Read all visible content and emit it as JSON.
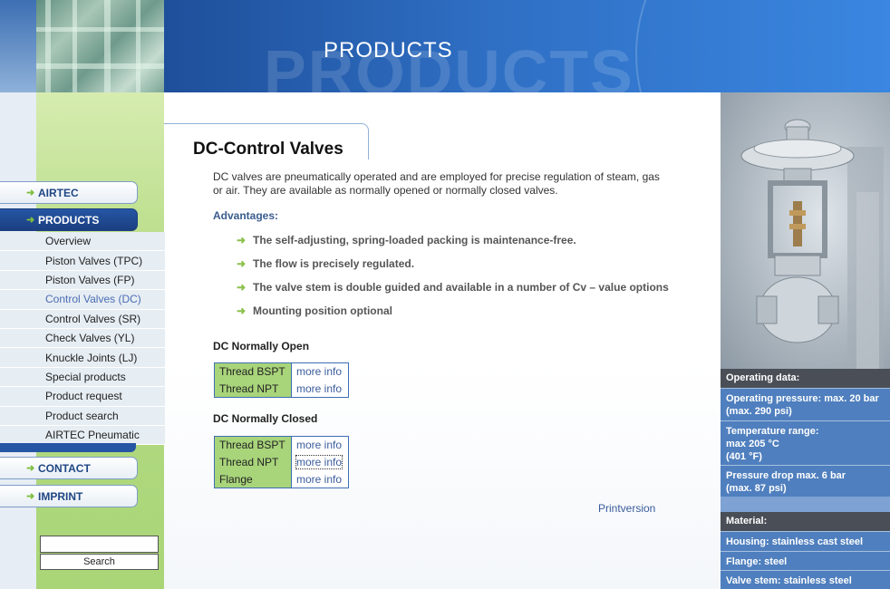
{
  "header": {
    "title": "PRODUCTS",
    "watermark": "PRODUCTS"
  },
  "page": {
    "title": "DC-Control Valves",
    "intro": "DC valves are pneumatically operated and are employed for precise regulation of steam, gas or air. They are available as normally opened or normally closed valves.",
    "advantages_label": "Advantages:",
    "advantages": [
      "The self-adjusting, spring-loaded packing is maintenance-free.",
      "The flow is precisely regulated.",
      "The valve stem is double guided and available in a number of Cv – value options",
      "Mounting position optional"
    ],
    "normally_open": {
      "heading": "DC Normally Open",
      "rows": [
        {
          "label": "Thread BSPT",
          "link": "more info"
        },
        {
          "label": "Thread NPT",
          "link": "more info"
        }
      ]
    },
    "normally_closed": {
      "heading": "DC Normally Closed",
      "rows": [
        {
          "label": "Thread BSPT",
          "link": "more info"
        },
        {
          "label": "Thread NPT",
          "link": "more info"
        },
        {
          "label": "Flange",
          "link": "more info"
        }
      ]
    },
    "printversion": "Printversion"
  },
  "nav": {
    "arrow": "➜",
    "airtec": "AIRTEC",
    "products": "PRODUCTS",
    "contact": "CONTACT",
    "imprint": "IMPRINT",
    "sub_items": [
      "Overview",
      "Piston Valves (TPC)",
      "Piston Valves (FP)",
      "Control Valves (DC)",
      "Control Valves (SR)",
      "Check Valves (YL)",
      "Knuckle Joints (LJ)",
      "Special products",
      "Product request",
      "Product search",
      "AIRTEC Pneumatic"
    ],
    "current_sub": "Control Valves (DC)"
  },
  "search": {
    "value": "",
    "button_label": "Search"
  },
  "specs": {
    "operating_heading": "Operating data:",
    "operating_pressure": "Operating pressure: max. 20 bar\n(max. 290 psi)",
    "temperature": "Temperature range:\nmax 205 °C\n(401 °F)",
    "pressure_drop": "Pressure drop max. 6 bar\n(max. 87 psi)",
    "material_heading": "Material:",
    "housing": "Housing: stainless cast steel",
    "flange": "Flange: steel",
    "valve_stem": "Valve stem: stainless steel"
  },
  "colors": {
    "brand_blue": "#1f4683",
    "accent_green": "#8cc14c",
    "link_blue": "#3a5c9c"
  }
}
